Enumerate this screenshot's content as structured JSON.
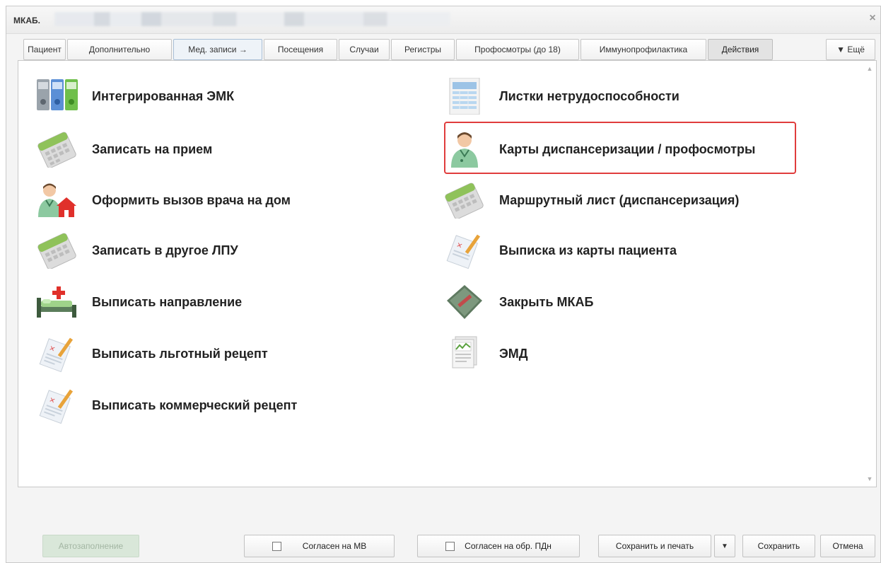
{
  "window": {
    "title": "МКАБ.",
    "close": "×"
  },
  "tabs": [
    {
      "label": "Пациент"
    },
    {
      "label": "Дополнительно"
    },
    {
      "label": "Мед. записи →"
    },
    {
      "label": "Посещения"
    },
    {
      "label": "Случаи"
    },
    {
      "label": "Регистры"
    },
    {
      "label": "Профосмотры (до 18)"
    },
    {
      "label": "Иммунопрофилактика"
    },
    {
      "label": "Действия"
    }
  ],
  "more_tab": {
    "label": "▼ Ещё"
  },
  "actions_left": [
    {
      "label": "Интегрированная ЭМК",
      "icon": "binders-icon"
    },
    {
      "label": "Записать на прием",
      "icon": "calendar-icon"
    },
    {
      "label": "Оформить вызов врача на дом",
      "icon": "doctor-home-icon"
    },
    {
      "label": "Записать в другое ЛПУ",
      "icon": "calendar-icon"
    },
    {
      "label": "Выписать направление",
      "icon": "hospital-bed-icon"
    },
    {
      "label": "Выписать льготный рецепт",
      "icon": "prescription-icon"
    },
    {
      "label": "Выписать коммерческий рецепт",
      "icon": "prescription-icon"
    }
  ],
  "actions_right": [
    {
      "label": "Листки нетрудоспособности",
      "icon": "document-table-icon"
    },
    {
      "label": "Карты диспансеризации / профосмотры",
      "icon": "doctor-icon"
    },
    {
      "label": "Маршрутный лист (диспансеризация)",
      "icon": "calendar-icon"
    },
    {
      "label": "Выписка из карты пациента",
      "icon": "prescription-icon"
    },
    {
      "label": "Закрыть МКАБ",
      "icon": "closed-book-icon"
    },
    {
      "label": "ЭМД",
      "icon": "document-chart-icon"
    }
  ],
  "footer": {
    "autofill": "Автозаполнение",
    "consent_mv": "Согласен на МВ",
    "consent_pdn": "Согласен на обр. ПДн",
    "save_print": "Сохранить и печать",
    "save": "Сохранить",
    "cancel": "Отмена"
  },
  "colors": {
    "highlight_border": "#e03c3c",
    "autofill_disabled_bg": "#d9e7d9"
  }
}
